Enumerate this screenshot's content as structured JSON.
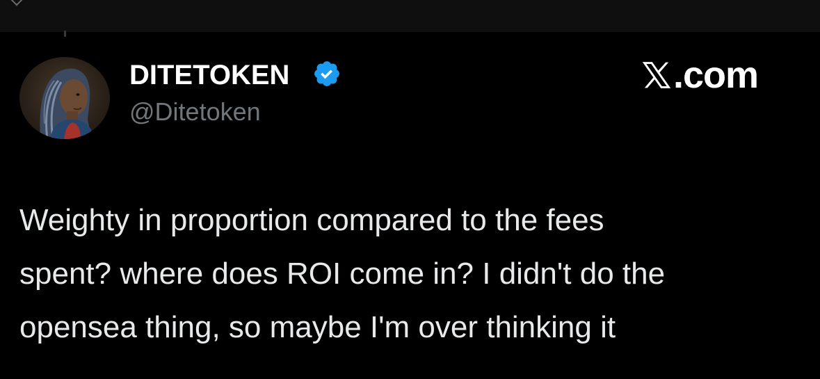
{
  "author": {
    "display_name": "DITETOKEN",
    "handle": "@Ditetoken",
    "verified": true
  },
  "brand": {
    "domain_suffix": ".com",
    "logo": "x-logo-icon"
  },
  "tweet": {
    "text": "Weighty in proportion compared to the fees\nspent? where does ROI come in? I didn't do the\nopensea thing, so maybe I'm over thinking it"
  },
  "colors": {
    "background": "#000000",
    "primary_text": "#e7e9ea",
    "secondary_text": "#71767b",
    "verified_badge": "#1d9bf0"
  }
}
